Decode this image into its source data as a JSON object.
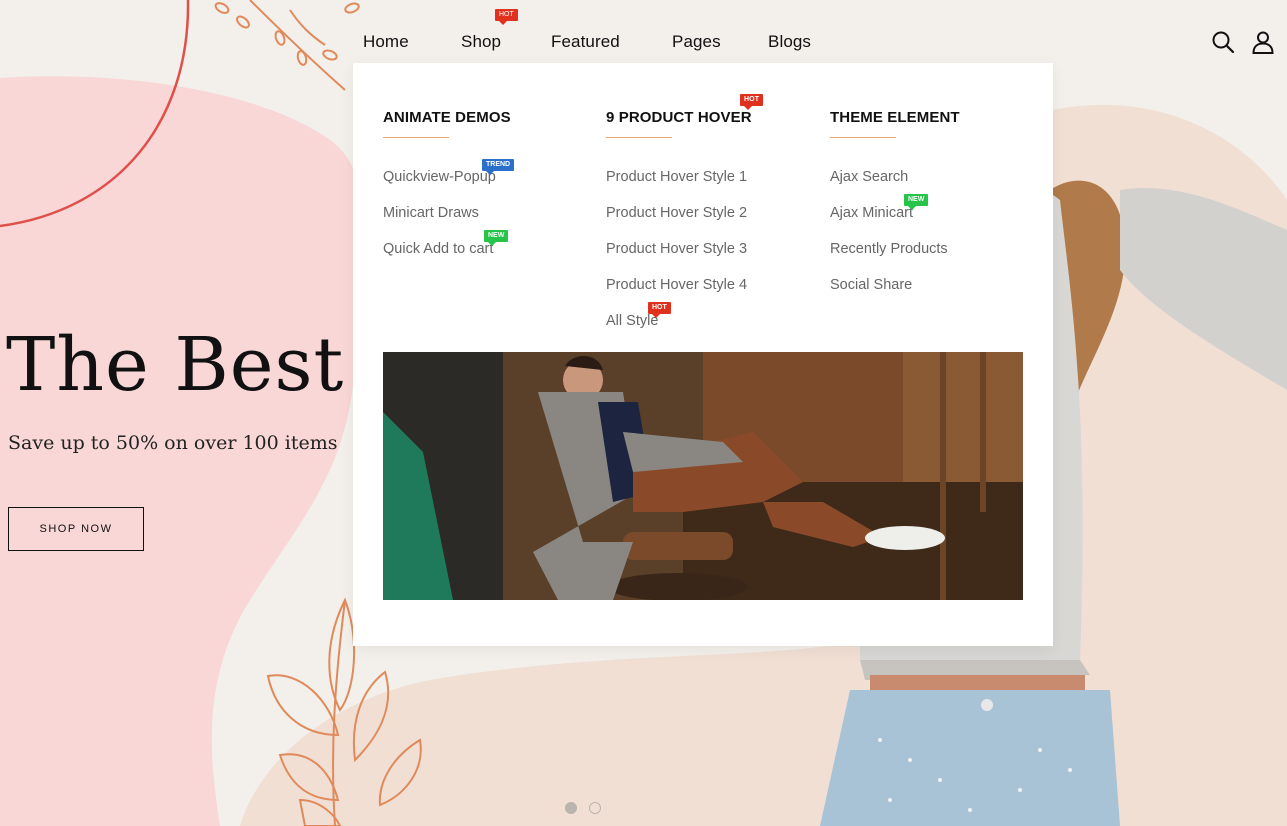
{
  "colors": {
    "background": "#f3efea",
    "pink_blob": "#f8d7d6",
    "peach_blob": "#f1dfd4",
    "accent_line": "#e3a872",
    "badge_hot": "#e0301e",
    "badge_trend": "#2a6fc9",
    "badge_new": "#27c44a"
  },
  "nav": {
    "home": "Home",
    "shop": "Shop",
    "shop_badge": "HOT",
    "featured": "Featured",
    "pages": "Pages",
    "blogs": "Blogs"
  },
  "header_icons": [
    "search-icon",
    "user-icon"
  ],
  "hero": {
    "title": "The Best Lo",
    "subtitle": "Save up to 50% on over 100 items",
    "button": "SHOP NOW"
  },
  "mega_menu": {
    "columns": [
      {
        "heading": "ANIMATE DEMOS",
        "items": [
          {
            "label": "Quickview-Popup",
            "badge": "TREND"
          },
          {
            "label": "Minicart Draws",
            "badge": ""
          },
          {
            "label": "Quick Add to cart",
            "badge": "NEW"
          }
        ]
      },
      {
        "heading": "9 PRODUCT HOVER",
        "heading_badge": "HOT",
        "items": [
          {
            "label": "Product Hover Style 1",
            "badge": ""
          },
          {
            "label": "Product Hover Style 2",
            "badge": ""
          },
          {
            "label": "Product Hover Style 3",
            "badge": ""
          },
          {
            "label": "Product Hover Style 4",
            "badge": ""
          },
          {
            "label": "All Style",
            "badge": "HOT"
          }
        ]
      },
      {
        "heading": "THEME ELEMENT",
        "items": [
          {
            "label": "Ajax Search",
            "badge": ""
          },
          {
            "label": "Ajax Minicart",
            "badge": "NEW"
          },
          {
            "label": "Recently Products",
            "badge": ""
          },
          {
            "label": "Social Share",
            "badge": ""
          }
        ]
      }
    ]
  },
  "slider": {
    "total": 2,
    "active": 1
  }
}
